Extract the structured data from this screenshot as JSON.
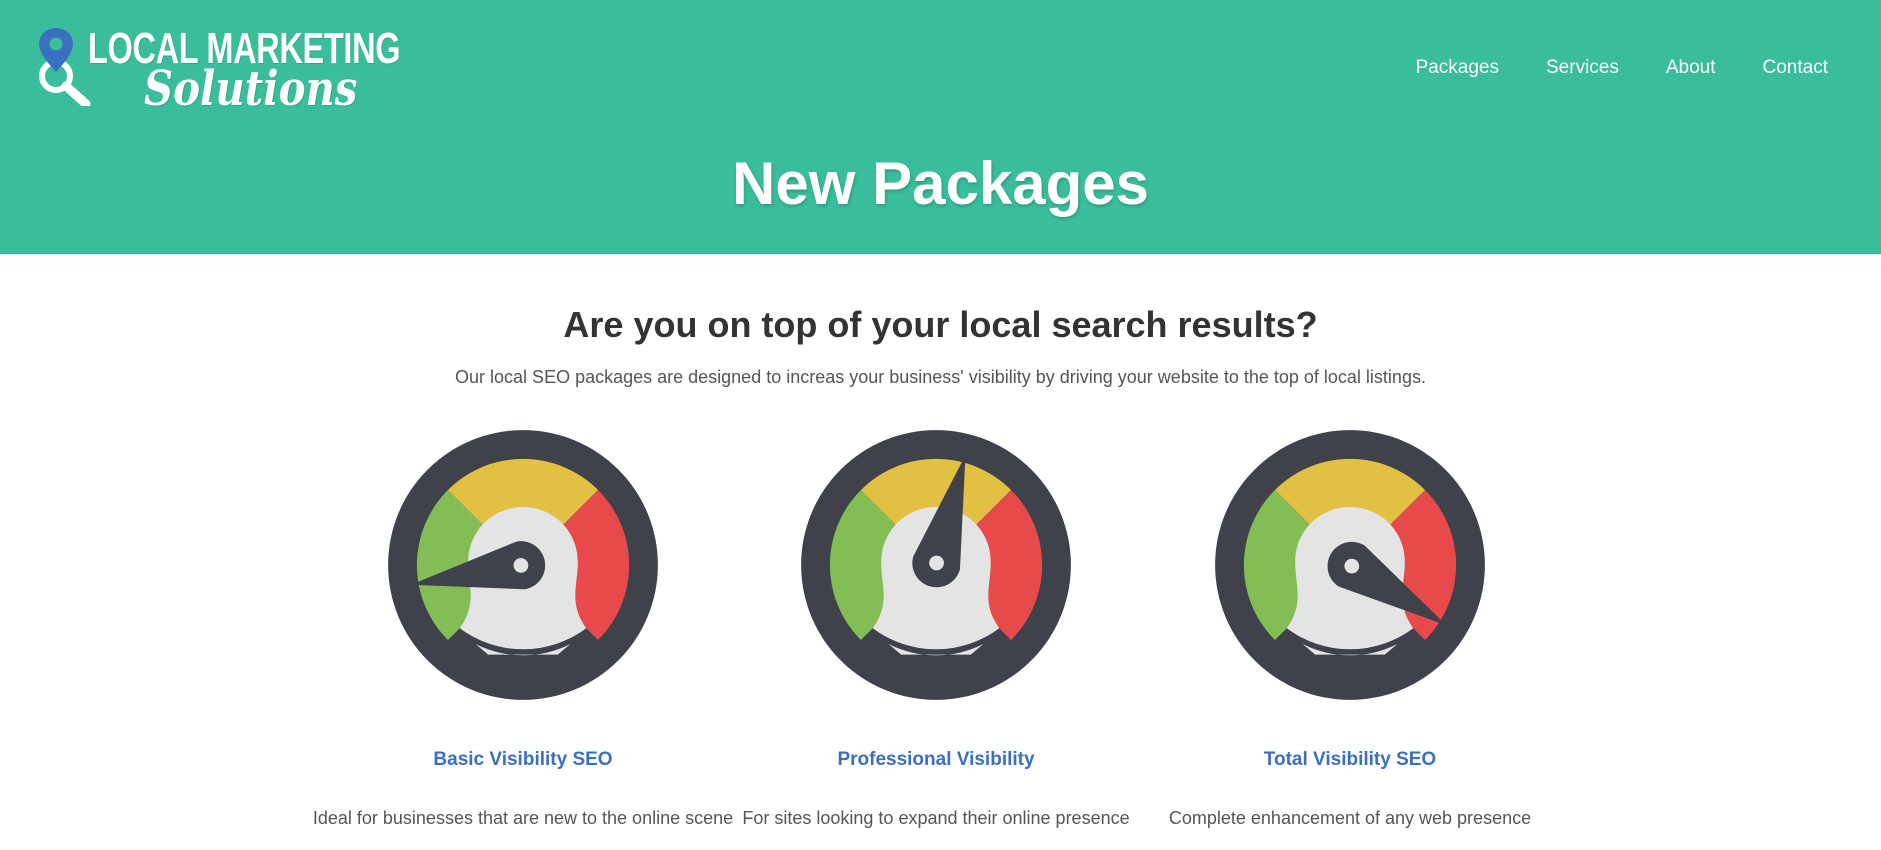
{
  "logo": {
    "line1": "LOCAL MARKETING",
    "line2": "Solutions",
    "icon": "map-pin-magnifier-icon"
  },
  "nav": {
    "items": [
      {
        "label": "Packages"
      },
      {
        "label": "Services"
      },
      {
        "label": "About"
      },
      {
        "label": "Contact"
      }
    ]
  },
  "hero": {
    "title": "New Packages"
  },
  "intro": {
    "headline": "Are you on top of your local search results?",
    "text": "Our local SEO packages are designed to increas your business' visibility by driving your website to the top of local listings."
  },
  "packages": [
    {
      "title": "Basic Visibility SEO",
      "description": "Ideal for businesses that are new to the online scene",
      "gauge_level": "low",
      "icon": "speedometer-icon"
    },
    {
      "title": "Professional Visibility",
      "description": "For sites looking to expand their online presence",
      "gauge_level": "medium",
      "icon": "speedometer-icon"
    },
    {
      "title": "Total Visibility SEO",
      "description": "Complete enhancement of any web presence",
      "gauge_level": "high",
      "icon": "speedometer-icon"
    }
  ],
  "colors": {
    "hero_bg": "#39bd9b",
    "link_blue": "#3b6fc0",
    "gauge_dark": "#3f414b",
    "gauge_green": "#82bd56",
    "gauge_yellow": "#e1c044",
    "gauge_red": "#e84a4c",
    "gauge_face": "#e4e4e4"
  }
}
